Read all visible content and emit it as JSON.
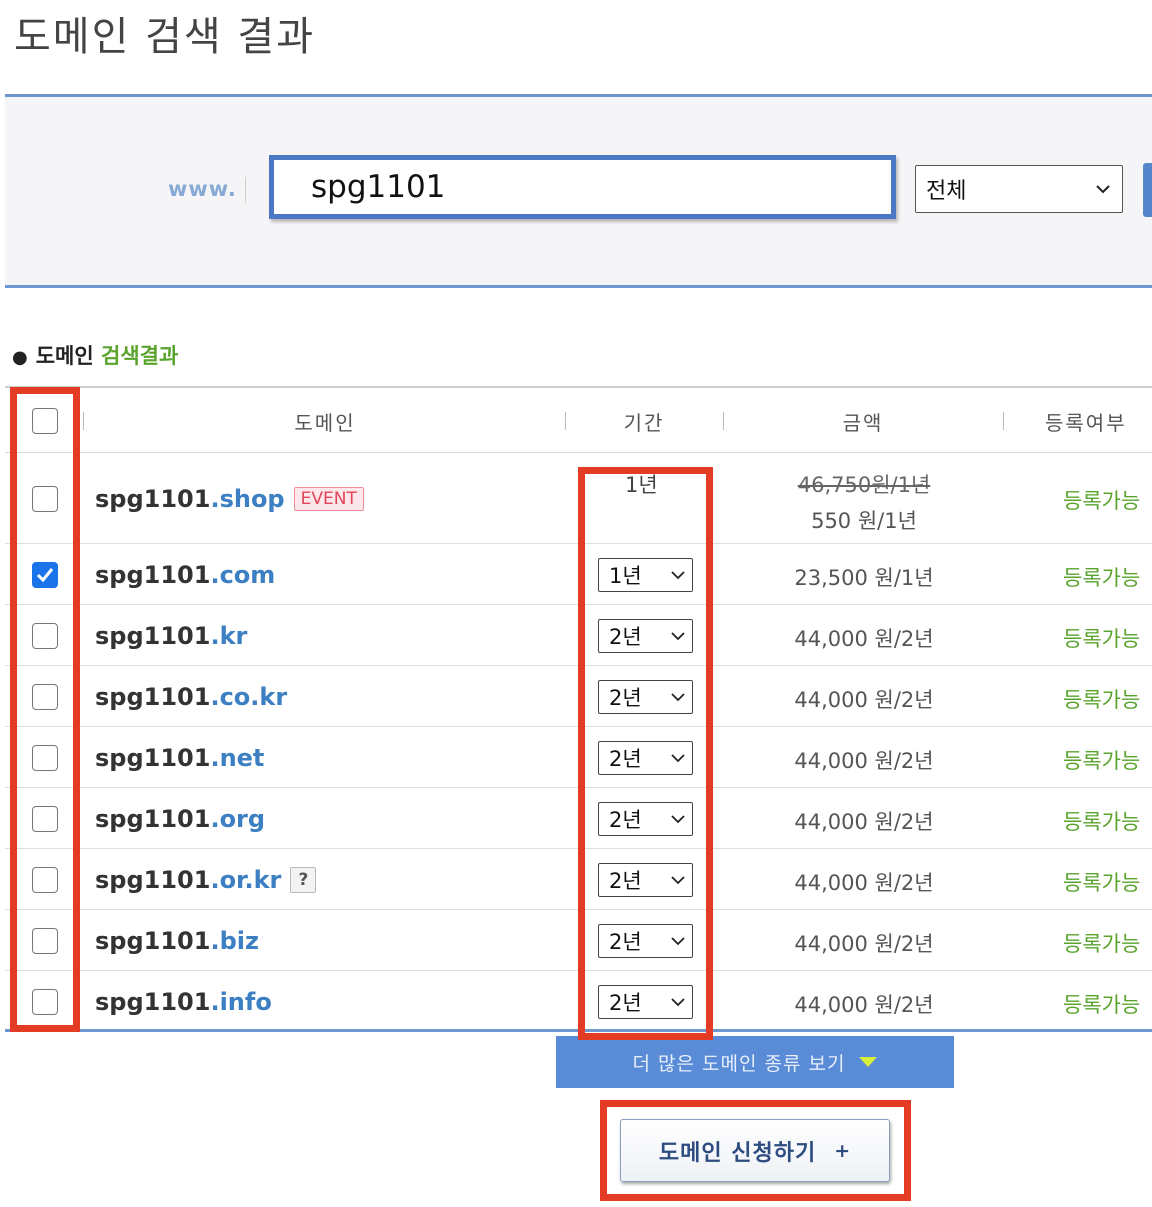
{
  "page_title": "도메인 검색 결과",
  "search": {
    "prefix": "www.",
    "query": "spg1101",
    "tld_filter": "전체"
  },
  "results": {
    "heading_prefix": "도메인",
    "heading_accent": "검색결과",
    "columns": {
      "domain": "도메인",
      "period": "기간",
      "price": "금액",
      "status": "등록여부"
    },
    "rows": [
      {
        "name": "spg1101",
        "tld": ".shop",
        "badge": "EVENT",
        "checked": false,
        "period": "1년",
        "period_editable": false,
        "price_old": "46,750원/1년",
        "price": "550 원/1년",
        "status": "등록가능"
      },
      {
        "name": "spg1101",
        "tld": ".com",
        "checked": true,
        "period": "1년",
        "period_editable": true,
        "price": "23,500 원/1년",
        "status": "등록가능"
      },
      {
        "name": "spg1101",
        "tld": ".kr",
        "checked": false,
        "period": "2년",
        "period_editable": true,
        "price": "44,000 원/2년",
        "status": "등록가능"
      },
      {
        "name": "spg1101",
        "tld": ".co.kr",
        "checked": false,
        "period": "2년",
        "period_editable": true,
        "price": "44,000 원/2년",
        "status": "등록가능"
      },
      {
        "name": "spg1101",
        "tld": ".net",
        "checked": false,
        "period": "2년",
        "period_editable": true,
        "price": "44,000 원/2년",
        "status": "등록가능"
      },
      {
        "name": "spg1101",
        "tld": ".org",
        "checked": false,
        "period": "2년",
        "period_editable": true,
        "price": "44,000 원/2년",
        "status": "등록가능"
      },
      {
        "name": "spg1101",
        "tld": ".or.kr",
        "help": "?",
        "checked": false,
        "period": "2년",
        "period_editable": true,
        "price": "44,000 원/2년",
        "status": "등록가능"
      },
      {
        "name": "spg1101",
        "tld": ".biz",
        "checked": false,
        "period": "2년",
        "period_editable": true,
        "price": "44,000 원/2년",
        "status": "등록가능"
      },
      {
        "name": "spg1101",
        "tld": ".info",
        "checked": false,
        "period": "2년",
        "period_editable": true,
        "price": "44,000 원/2년",
        "status": "등록가능"
      }
    ]
  },
  "more_button": "더 많은 도메인 종류 보기",
  "apply_button": "도메인 신청하기",
  "apply_button_icon": "+",
  "colors": {
    "accent_blue": "#4a78c2",
    "available_green": "#5aa32c",
    "annotation_red": "#e43b24"
  }
}
